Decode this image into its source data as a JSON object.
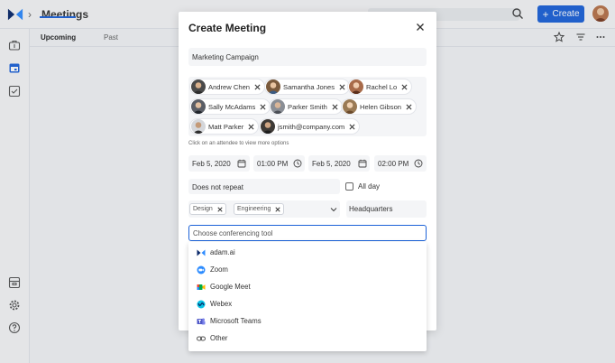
{
  "app": {
    "title": "Meetings",
    "create_label": "Create"
  },
  "tabs": [
    {
      "label": "Upcoming",
      "active": true
    },
    {
      "label": "Past",
      "active": false
    }
  ],
  "sidebar": {
    "icons": [
      "briefcase-icon",
      "calendar-icon",
      "checklist-icon",
      "archive-icon",
      "settings-icon",
      "help-icon"
    ]
  },
  "modal": {
    "title": "Create Meeting",
    "meeting_title": "Marketing Campaign",
    "attendees": [
      {
        "name": "Andrew Chen"
      },
      {
        "name": "Samantha Jones"
      },
      {
        "name": "Rachel Lo"
      },
      {
        "name": "Sally McAdams"
      },
      {
        "name": "Parker Smith"
      },
      {
        "name": "Helen Gibson"
      },
      {
        "name": "Matt Parker"
      },
      {
        "name": "jsmith@company.com"
      }
    ],
    "attendee_hint": "Click on an attendee to view more options",
    "start_date": "Feb 5, 2020",
    "start_time": "01:00 PM",
    "end_date": "Feb 5, 2020",
    "end_time": "02:00 PM",
    "repeat": "Does not repeat",
    "all_day_label": "All day",
    "tags": [
      "Design",
      "Engineering"
    ],
    "location": "Headquarters",
    "conferencing_placeholder": "Choose conferencing tool",
    "conferencing_options": [
      {
        "label": "adam.ai",
        "icon": "adam-ai-logo-icon"
      },
      {
        "label": "Zoom",
        "icon": "zoom-icon"
      },
      {
        "label": "Google Meet",
        "icon": "google-meet-icon"
      },
      {
        "label": "Webex",
        "icon": "webex-icon"
      },
      {
        "label": "Microsoft Teams",
        "icon": "microsoft-teams-icon"
      },
      {
        "label": "Other",
        "icon": "link-icon"
      }
    ]
  },
  "colors": {
    "accent": "#1d63d8",
    "brand_dark": "#0b2a6b",
    "brand_light": "#2f8cff"
  }
}
